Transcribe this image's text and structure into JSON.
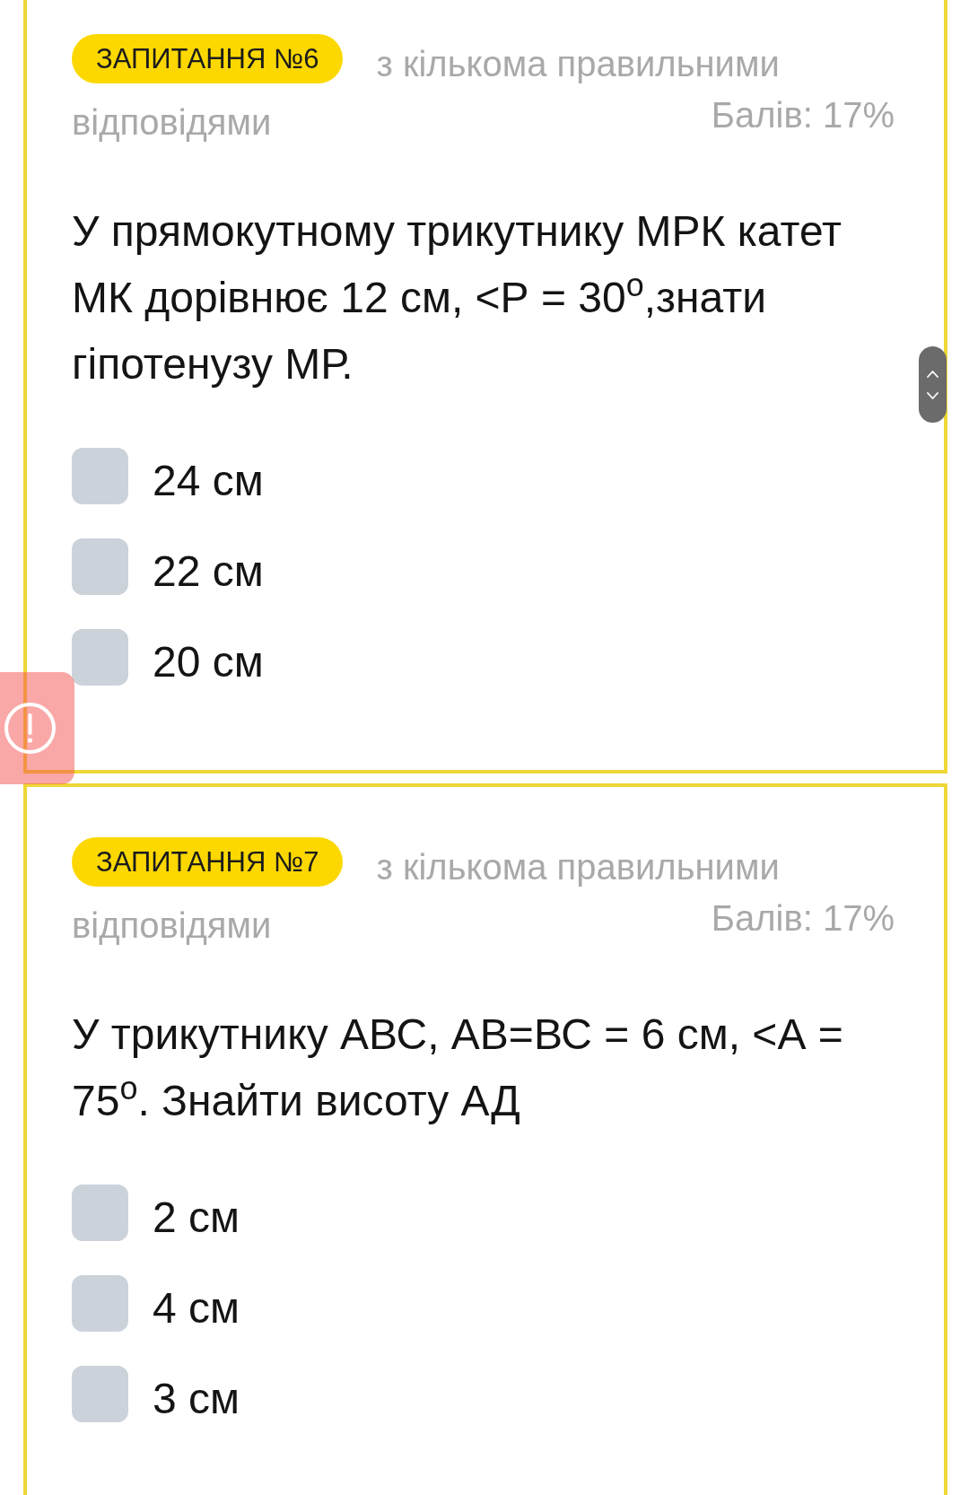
{
  "questions": [
    {
      "badge": "ЗАПИТАННЯ №6",
      "type": "з кількома правильними відповідями",
      "points": "Балів: 17%",
      "text": "У прямокутному трикутнику МРК катет МК дорівнює 12 см, <Р = 30$^{o}$,знати гіпотенузу МР.",
      "options": [
        {
          "label": "24 см",
          "checked": false
        },
        {
          "label": "22 см",
          "checked": false
        },
        {
          "label": "20 см",
          "checked": false
        }
      ]
    },
    {
      "badge": "ЗАПИТАННЯ №7",
      "type": "з кількома правильними відповідями",
      "points": "Балів: 17%",
      "text": "У трикутнику АВС, АВ=ВС = 6 см, <А = 75$^{o}$. Знайти висоту АД",
      "options": [
        {
          "label": "2 см",
          "checked": false
        },
        {
          "label": "4 см",
          "checked": false
        },
        {
          "label": "3 см",
          "checked": false
        }
      ]
    }
  ]
}
